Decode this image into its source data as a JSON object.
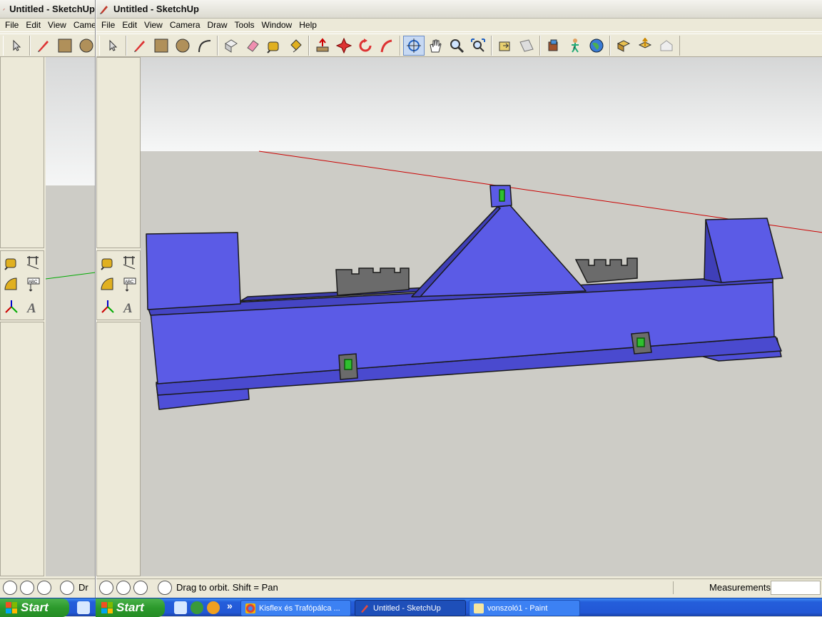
{
  "left_window": {
    "title": "Untitled - SketchUp",
    "menu": [
      "File",
      "Edit",
      "View",
      "Camera"
    ],
    "status": {
      "text": "Dr"
    }
  },
  "right_window": {
    "title": "Untitled - SketchUp",
    "menu": [
      "File",
      "Edit",
      "View",
      "Camera",
      "Draw",
      "Tools",
      "Window",
      "Help"
    ],
    "status": {
      "text": "Drag to orbit.  Shift = Pan",
      "measurements_label": "Measurements",
      "measurements_value": ""
    }
  },
  "toolbar_icons": [
    "select-icon",
    "pencil-icon",
    "rectangle-icon",
    "circle-icon",
    "arc-icon",
    "eraser-icon",
    "paint-bucket-icon",
    "tape-measure-icon",
    "push-pull-icon",
    "move-icon",
    "rotate-icon",
    "follow-me-icon",
    "orbit-icon",
    "pan-icon",
    "zoom-icon",
    "zoom-extents-icon",
    "component-icon",
    "section-icon",
    "3d-warehouse-icon",
    "walk-icon",
    "google-earth-icon",
    "get-models-icon",
    "share-model-icon",
    "preview-icon"
  ],
  "side_icons": [
    "tape-measure-icon",
    "dimension-icon",
    "protractor-icon",
    "text-icon",
    "axes-icon",
    "3d-text-icon"
  ],
  "colors": {
    "sky": "#f5f6f6",
    "ground": "#cdccc6",
    "model": "#5b5be6",
    "edge": "#1a1a1a",
    "red_axis": "#cc0000",
    "green_axis": "#00aa00"
  },
  "taskbar": {
    "start_label": "Start",
    "tasks": [
      {
        "label": "Kisflex és Trafópálca ..."
      },
      {
        "label": "Untitled - SketchUp"
      },
      {
        "label": "vonszoló1 - Paint"
      }
    ],
    "overflow": "»"
  }
}
